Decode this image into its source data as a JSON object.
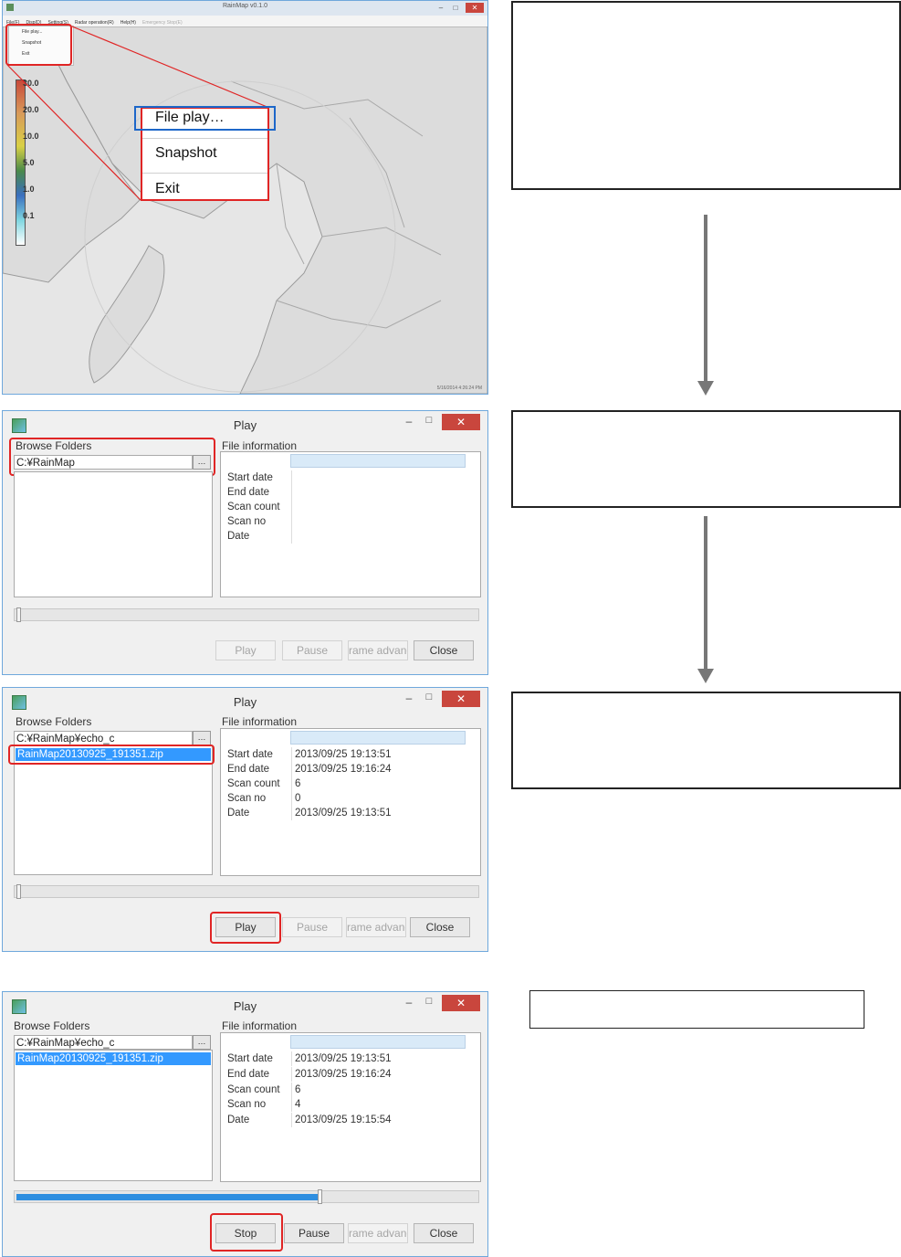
{
  "main_window": {
    "title": "RainMap v0.1.0",
    "menu": [
      "File(F)",
      "Disp(D)",
      "Setting(S)",
      "Radar operation(R)",
      "Help(H)",
      "Emergency Stop(E)"
    ],
    "small_menu": [
      "File play...",
      "Snapshot",
      "Exit"
    ],
    "legend": [
      "30.0",
      "20.0",
      "10.0",
      "5.0",
      "1.0",
      "0.1"
    ],
    "popup_menu": [
      "File play…",
      "Snapshot",
      "Exit"
    ],
    "status": "5/16/2014 4:26:24 PM"
  },
  "dialogs": [
    {
      "title": "Play",
      "browse_label": "Browse Folders",
      "info_label": "File information",
      "path": "C:¥RainMap",
      "browse_button": "…",
      "file": "",
      "info": [
        {
          "k": "Start date",
          "v": ""
        },
        {
          "k": "End date",
          "v": ""
        },
        {
          "k": "Scan count",
          "v": ""
        },
        {
          "k": "Scan no",
          "v": ""
        },
        {
          "k": "Date",
          "v": ""
        }
      ],
      "progress": 0,
      "buttons": [
        "Play",
        "Pause",
        "rame advanc",
        "Close"
      ]
    },
    {
      "title": "Play",
      "browse_label": "Browse Folders",
      "info_label": "File information",
      "path": "C:¥RainMap¥echo_c",
      "browse_button": "…",
      "file": "RainMap20130925_191351.zip",
      "info": [
        {
          "k": "Start date",
          "v": "2013/09/25 19:13:51"
        },
        {
          "k": "End date",
          "v": "2013/09/25 19:16:24"
        },
        {
          "k": "Scan count",
          "v": "6"
        },
        {
          "k": "Scan no",
          "v": "0"
        },
        {
          "k": "Date",
          "v": "2013/09/25 19:13:51"
        }
      ],
      "progress": 0,
      "buttons": [
        "Play",
        "Pause",
        "rame advanc",
        "Close"
      ]
    },
    {
      "title": "Play",
      "browse_label": "Browse Folders",
      "info_label": "File information",
      "path": "C:¥RainMap¥echo_c",
      "browse_button": "…",
      "file": "RainMap20130925_191351.zip",
      "info": [
        {
          "k": "Start date",
          "v": "2013/09/25 19:13:51"
        },
        {
          "k": "End date",
          "v": "2013/09/25 19:16:24"
        },
        {
          "k": "Scan count",
          "v": "6"
        },
        {
          "k": "Scan no",
          "v": "4"
        },
        {
          "k": "Date",
          "v": "2013/09/25 19:15:54"
        }
      ],
      "progress": 0.66,
      "buttons": [
        "Stop",
        "Pause",
        "rame advanc",
        "Close"
      ]
    }
  ],
  "colors": {
    "highlight_red": "#e02525",
    "highlight_blue": "#1d67c9",
    "selection_blue": "#3399ff",
    "close_red": "#c9463d"
  }
}
